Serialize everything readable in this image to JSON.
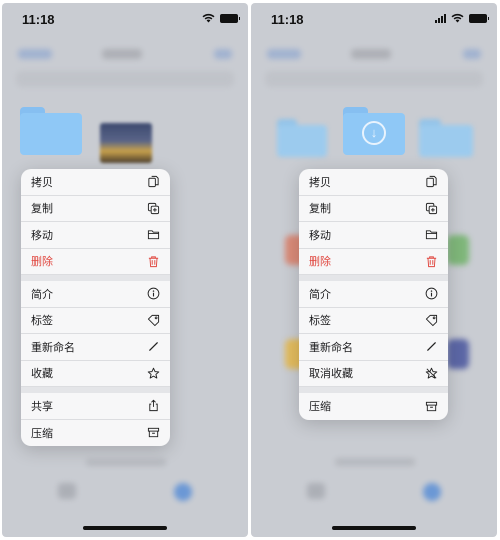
{
  "screens": [
    {
      "status_time": "11:18",
      "menu": {
        "groups": [
          [
            {
              "label": "拷贝",
              "icon": "copy-doc-icon"
            },
            {
              "label": "复制",
              "icon": "duplicate-icon"
            },
            {
              "label": "移动",
              "icon": "folder-icon"
            },
            {
              "label": "删除",
              "icon": "trash-icon",
              "destructive": true
            }
          ],
          [
            {
              "label": "简介",
              "icon": "info-icon"
            },
            {
              "label": "标签",
              "icon": "tag-icon"
            },
            {
              "label": "重新命名",
              "icon": "pencil-icon"
            },
            {
              "label": "收藏",
              "icon": "star-icon"
            }
          ],
          [
            {
              "label": "共享",
              "icon": "share-icon"
            },
            {
              "label": "压缩",
              "icon": "archive-icon"
            }
          ]
        ]
      }
    },
    {
      "status_time": "11:18",
      "menu": {
        "groups": [
          [
            {
              "label": "拷贝",
              "icon": "copy-doc-icon"
            },
            {
              "label": "复制",
              "icon": "duplicate-icon"
            },
            {
              "label": "移动",
              "icon": "folder-icon"
            },
            {
              "label": "删除",
              "icon": "trash-icon",
              "destructive": true
            }
          ],
          [
            {
              "label": "简介",
              "icon": "info-icon"
            },
            {
              "label": "标签",
              "icon": "tag-icon"
            },
            {
              "label": "重新命名",
              "icon": "pencil-icon"
            },
            {
              "label": "取消收藏",
              "icon": "star-slash-icon"
            }
          ],
          [
            {
              "label": "压缩",
              "icon": "archive-icon"
            }
          ]
        ]
      }
    }
  ],
  "colors": {
    "destructive": "#e0463e",
    "folder": "#8fc8f6",
    "background": "#c9ccd2"
  }
}
